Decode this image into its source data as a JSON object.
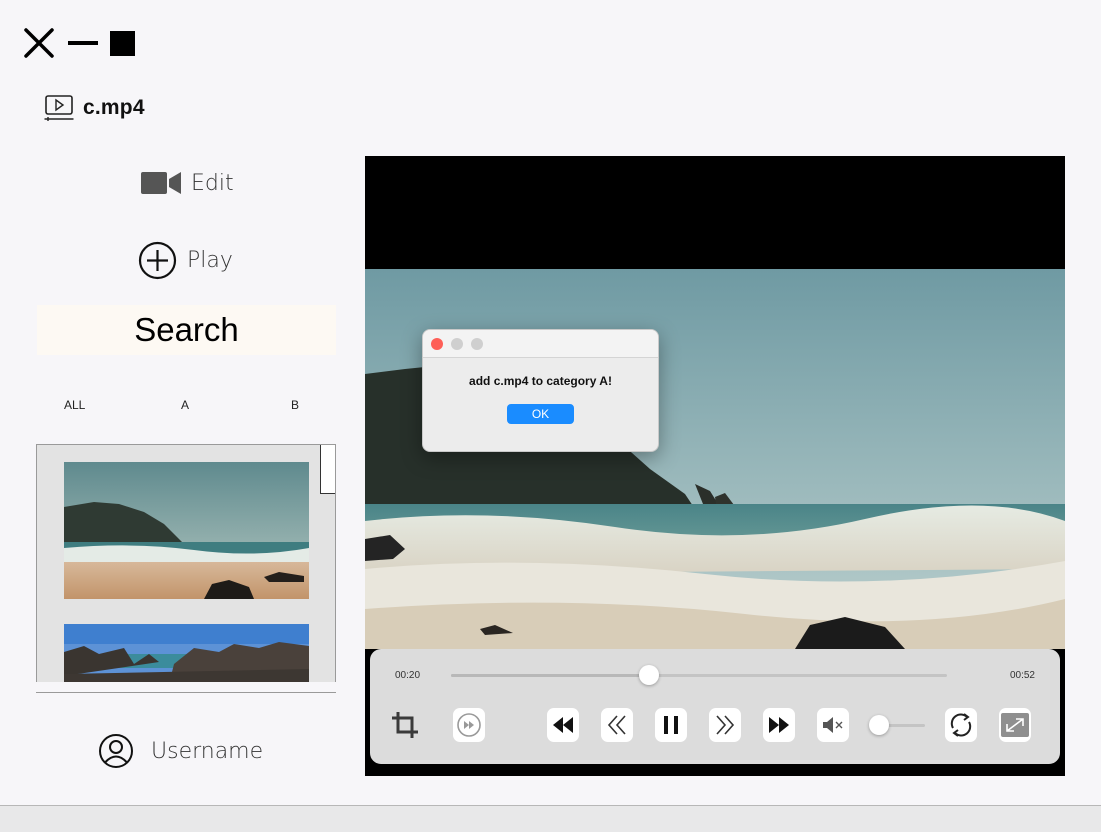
{
  "window": {
    "title": "c.mp4",
    "controls": [
      "close-icon",
      "minimize-icon",
      "maximize-icon"
    ]
  },
  "sidebar": {
    "edit_label": "Edit",
    "play_label": "Play",
    "search_label": "Search",
    "filters": [
      "ALL",
      "A",
      "B"
    ],
    "username": "Username"
  },
  "dialog": {
    "message": "add c.mp4 to category A!",
    "ok_label": "OK"
  },
  "player": {
    "current_time": "00:20",
    "total_time": "00:52",
    "progress": 0.4,
    "volume": 0.0,
    "muted": true
  },
  "colors": {
    "accent": "#1a8cff",
    "traffic_close": "#fe5f57",
    "traffic_inactive": "#cfcfcf"
  }
}
